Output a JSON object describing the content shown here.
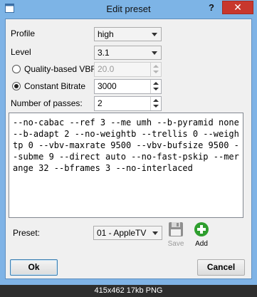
{
  "window": {
    "title": "Edit preset",
    "help_label": "?",
    "close_label": "✕"
  },
  "form": {
    "profile": {
      "label": "Profile",
      "value": "high"
    },
    "level": {
      "label": "Level",
      "value": "3.1"
    },
    "quality_vbr": {
      "label": "Quality-based VBR",
      "value": "20.0",
      "selected": false,
      "enabled": false
    },
    "constant_bitrate": {
      "label": "Constant Bitrate",
      "value": "3000",
      "selected": true
    },
    "passes": {
      "label": "Number of passes:",
      "value": "2"
    }
  },
  "options_text": "--no-cabac --ref 3 --me umh --b-pyramid none --b-adapt 2 --no-weightb --trellis 0 --weightp 0 --vbv-maxrate 9500 --vbv-bufsize 9500 --subme 9 --direct auto --no-fast-pskip --merange 32 --bframes 3 --no-interlaced",
  "preset": {
    "label": "Preset:",
    "value": "01 - AppleTV",
    "save_label": "Save",
    "add_label": "Add"
  },
  "buttons": {
    "ok": "Ok",
    "cancel": "Cancel"
  },
  "image_caption": "415x462  17kb  PNG",
  "colors": {
    "titlebar": "#7db4e6",
    "close": "#c8372d",
    "add_icon": "#2e9e2e",
    "save_icon": "#9a9a9a"
  },
  "icons": {
    "app": "app-window-icon",
    "save": "floppy-disk-icon",
    "add": "plus-circle-icon"
  }
}
